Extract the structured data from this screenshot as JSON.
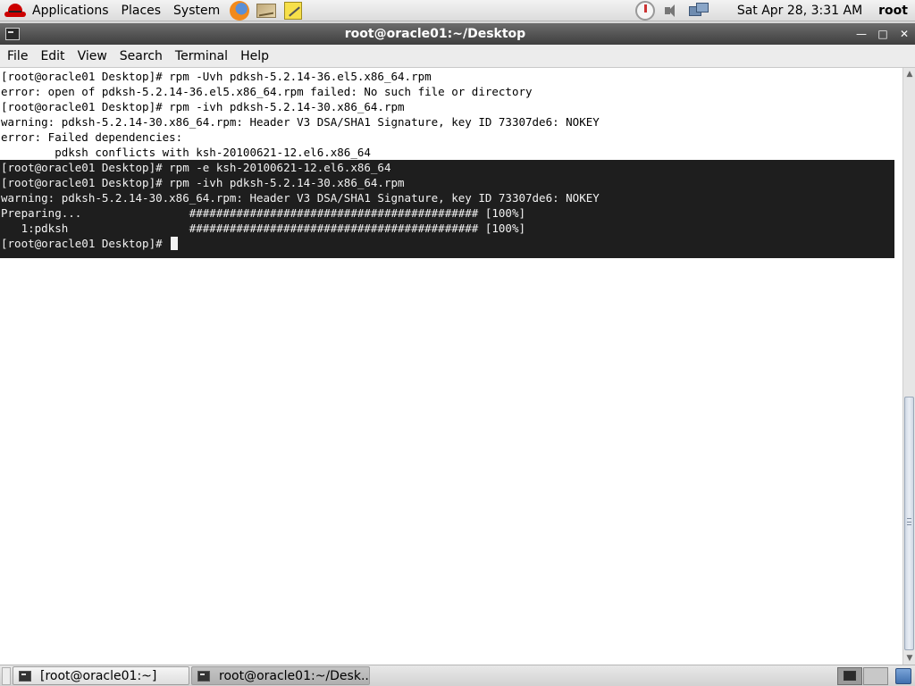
{
  "top_panel": {
    "menus": [
      "Applications",
      "Places",
      "System"
    ],
    "launchers": [
      "firefox-icon",
      "mail-icon",
      "notes-icon"
    ],
    "tray": [
      "update-icon",
      "volume-icon",
      "network-icon"
    ],
    "clock": "Sat Apr 28,  3:31 AM",
    "user": "root"
  },
  "window": {
    "title": "root@oracle01:~/Desktop",
    "controls": [
      "minimize",
      "maximize",
      "close"
    ]
  },
  "menubar": [
    "File",
    "Edit",
    "View",
    "Search",
    "Terminal",
    "Help"
  ],
  "terminal": {
    "lines": [
      "[root@oracle01 Desktop]# rpm -Uvh pdksh-5.2.14-36.el5.x86_64.rpm",
      "error: open of pdksh-5.2.14-36.el5.x86_64.rpm failed: No such file or directory",
      "[root@oracle01 Desktop]# rpm -ivh pdksh-5.2.14-30.x86_64.rpm",
      "warning: pdksh-5.2.14-30.x86_64.rpm: Header V3 DSA/SHA1 Signature, key ID 73307de6: NOKEY",
      "error: Failed dependencies:",
      "        pdksh conflicts with ksh-20100621-12.el6.x86_64"
    ],
    "selected_lines": [
      "[root@oracle01 Desktop]# rpm -e ksh-20100621-12.el6.x86_64",
      "[root@oracle01 Desktop]# rpm -ivh pdksh-5.2.14-30.x86_64.rpm",
      "warning: pdksh-5.2.14-30.x86_64.rpm: Header V3 DSA/SHA1 Signature, key ID 73307de6: NOKEY",
      "Preparing...                ########################################### [100%]",
      "   1:pdksh                  ########################################### [100%]"
    ],
    "prompt": "[root@oracle01 Desktop]# "
  },
  "taskbar": {
    "tasks": [
      "[root@oracle01:~]",
      "root@oracle01:~/Desk..."
    ],
    "active_task_index": 1
  },
  "colors": {
    "selection_bg": "#1e1e1e",
    "titlebar_bg": "#4a4a4a",
    "terminal_bg": "#ffffff"
  }
}
